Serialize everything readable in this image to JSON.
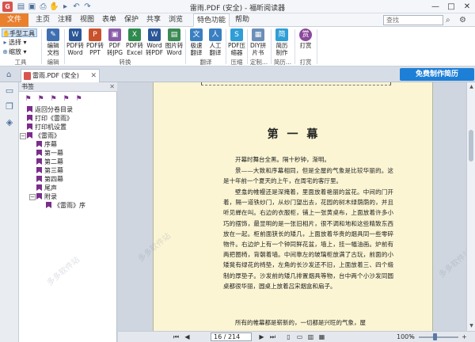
{
  "window": {
    "title": "雷雨.PDF (安全) - 福昕阅读器",
    "minimize": "—",
    "maximize": "□",
    "close": "✕"
  },
  "menu": {
    "file": "文件",
    "tabs": [
      "主页",
      "注释",
      "视图",
      "表单",
      "保护",
      "共享",
      "浏览",
      "特色功能",
      "帮助"
    ],
    "active_tab": "特色功能",
    "search_placeholder": "查找"
  },
  "ribbon": {
    "tools": {
      "hand": "手型工具",
      "select": "选择",
      "zoom": "缩放",
      "group": "工具"
    },
    "buttons": [
      {
        "line1": "编辑",
        "line2": "文档",
        "color": "#3f6fb0"
      },
      {
        "line1": "PDF转",
        "line2": "Word",
        "color": "#2b5797"
      },
      {
        "line1": "PDF转",
        "line2": "PPT",
        "color": "#c9522c"
      },
      {
        "line1": "PDF",
        "line2": "转JPG",
        "color": "#8b5ca8"
      },
      {
        "line1": "PDF转",
        "line2": "Excel",
        "color": "#2f8a4e"
      },
      {
        "line1": "Word",
        "line2": "转PDF",
        "color": "#2b5797"
      },
      {
        "line1": "图片转",
        "line2": "Word",
        "color": "#3d8a55"
      },
      {
        "line1": "极速",
        "line2": "翻译",
        "color": "#3a7fc1"
      },
      {
        "line1": "人工",
        "line2": "翻译",
        "color": "#3a7fc1"
      },
      {
        "line1": "PDF压",
        "line2": "缩器",
        "color": "#2f9ed6"
      },
      {
        "line1": "DIY拼",
        "line2": "片书",
        "color": "#6b8fb8"
      },
      {
        "line1": "简历",
        "line2": "制作",
        "color": "#2f9ed6"
      },
      {
        "line1": "打赏",
        "line2": "",
        "color": "#8b4a9c",
        "glyph": "赏"
      }
    ],
    "groups": [
      "编辑",
      "转换",
      "翻译",
      "压缩",
      "定制...",
      "简历...",
      "打赏"
    ]
  },
  "ad_button": "免费制作简历",
  "document_tab": {
    "name": "雷雨.PDF (安全)",
    "close": "✕"
  },
  "bookmarks": {
    "title": "书签",
    "items": [
      {
        "label": "返回分卷目录",
        "level": 1
      },
      {
        "label": "打印《雷雨》",
        "level": 1
      },
      {
        "label": "打印机设置",
        "level": 1
      },
      {
        "label": "《雷雨》",
        "level": 1,
        "toggle": "−"
      },
      {
        "label": "序幕",
        "level": 2
      },
      {
        "label": "第一幕",
        "level": 2
      },
      {
        "label": "第二幕",
        "level": 2
      },
      {
        "label": "第三幕",
        "level": 2
      },
      {
        "label": "第四幕",
        "level": 2
      },
      {
        "label": "尾声",
        "level": 2
      },
      {
        "label": "附录",
        "level": 2,
        "toggle": "−"
      },
      {
        "label": "《雷雨》序",
        "level": 3
      }
    ]
  },
  "page": {
    "chapter_title": "第 一 幕",
    "paragraphs": [
      "开幕时舞台全黑。隔十秒钟，渐明。",
      "景——大致和序幕相同，但是全屋的气象是比较华丽的。这是十年前一个夏天的上午，在周宅的客厅里。",
      "壁龛的帷幔还是深掩着，里面放着艳丽的盆花。中间的门开着，隔一道铁纱门，从纱门望出去，花园的树木绿荫荫的，并且听见蝉在叫。右边的衣服柜，铺上一张黄桌布，上面放着许多小巧的摆饰，最显明的是一张旧相片，很不调和地和这些精致东西放在一起。柜前面狭长的矮几，上面放着华贵的烟具同一些零碎物件。右边炉上有一个钟同鲜花盆，墙上，挂一幅油画。炉前有两把圈椅，背朝着墙。中间靠左的玻璃柜放满了古玩，前面的小矮凳有绿花的椅垫，左角的长沙发还不旧，上面放着三、四个缎制的厚垫子。沙发前的矮几排置烟具等物，台中两个小沙发同圆桌都很华丽，圆桌上放着吕宋烟盒和扇子。",
      "所有的帷幕都是崭新的，一切都是兴旺的气象，屋"
    ]
  },
  "status": {
    "page_indicator": "16 / 214",
    "zoom": "100%",
    "zoom_fraction": 0.4
  },
  "watermark": "多多软件站"
}
